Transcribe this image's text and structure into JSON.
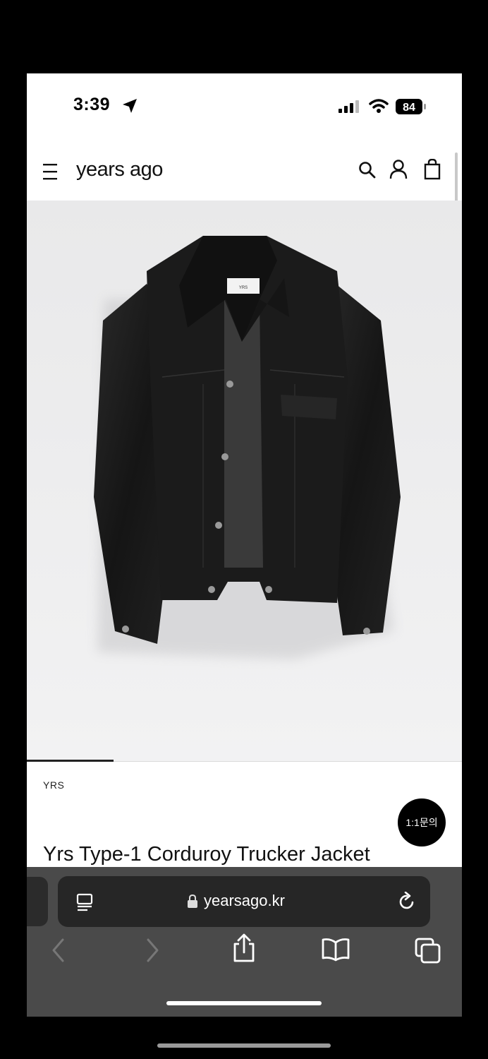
{
  "status_bar": {
    "time": "3:39",
    "battery": "84"
  },
  "header": {
    "logo": "years ago"
  },
  "product": {
    "image_tag_text": "YRS",
    "brand": "YRS",
    "title": "Yrs Type-1 Corduroy Trucker Jacket"
  },
  "chat_button": {
    "label": "1:1문의"
  },
  "browser": {
    "url": "yearsago.kr"
  },
  "icons": [
    "location-arrow-icon",
    "signal-icon",
    "wifi-icon",
    "battery-icon",
    "menu-icon",
    "search-icon",
    "user-icon",
    "bag-icon",
    "reader-icon",
    "lock-icon",
    "reload-icon",
    "back-icon",
    "forward-icon",
    "share-icon",
    "bookmarks-icon",
    "tabs-icon"
  ]
}
